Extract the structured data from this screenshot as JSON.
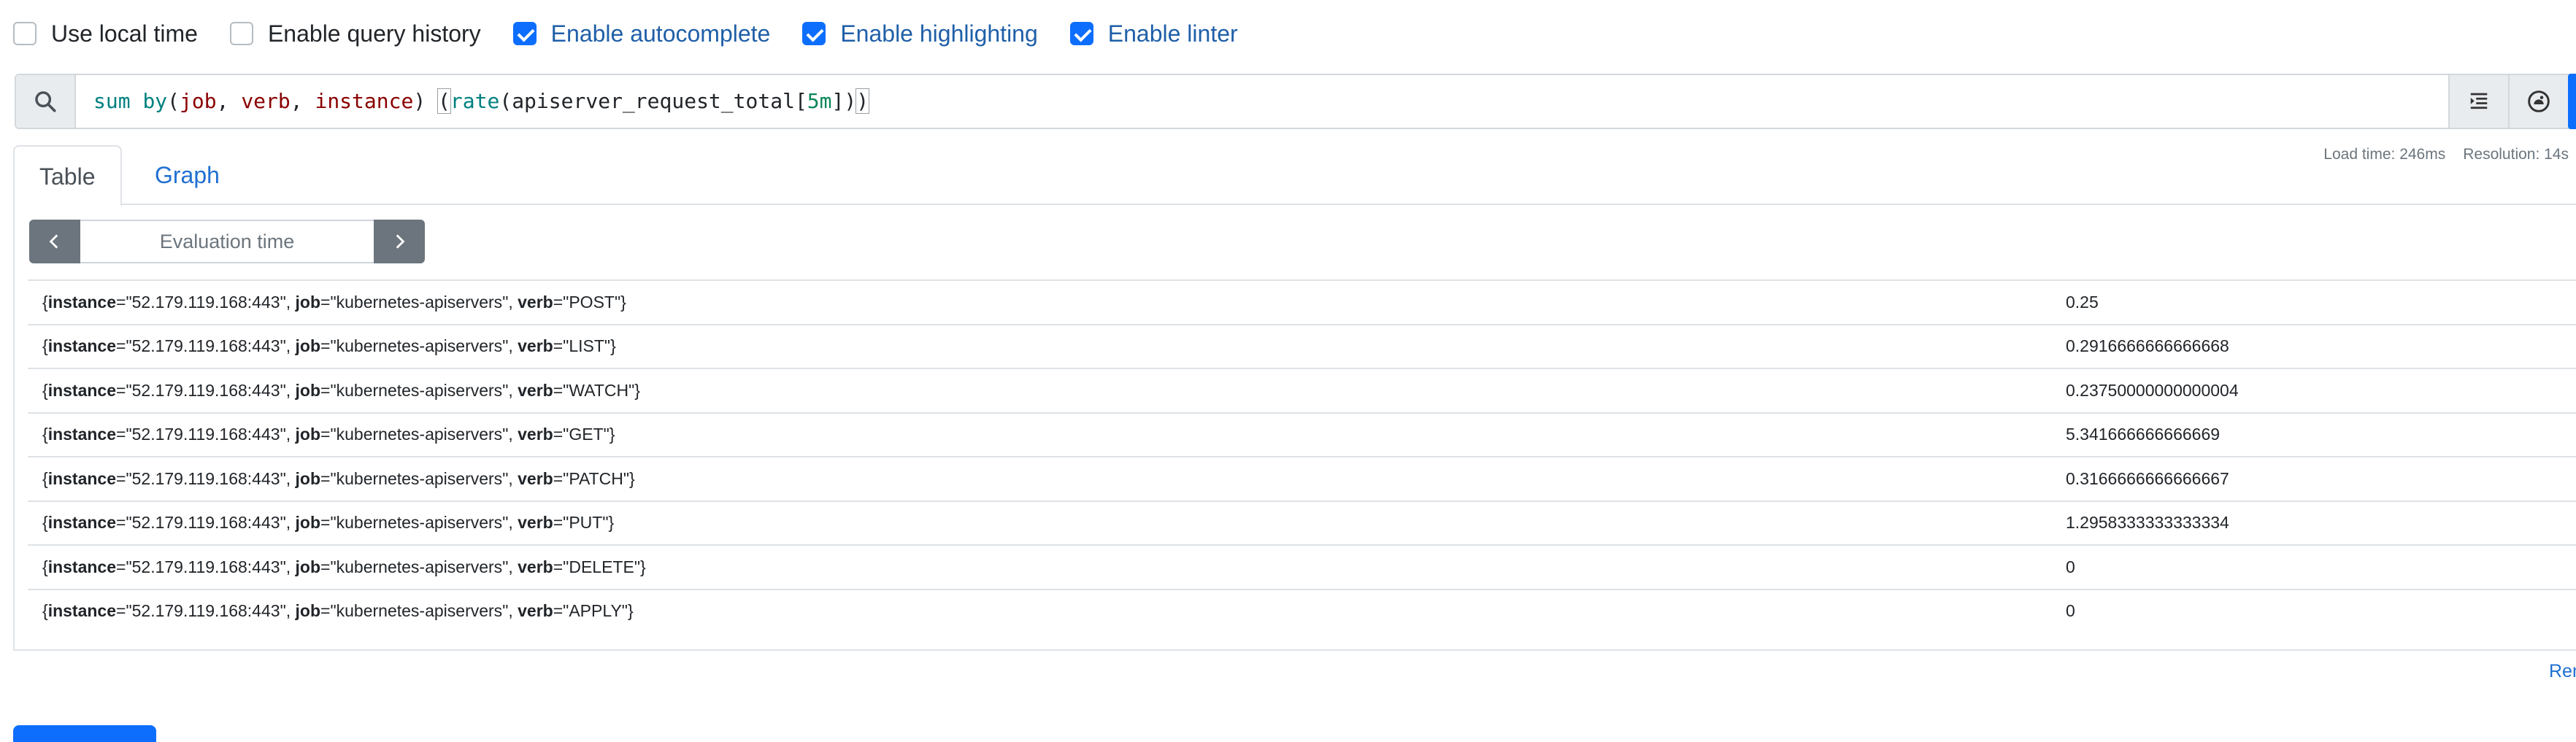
{
  "options": [
    {
      "label": "Use local time",
      "checked": false
    },
    {
      "label": "Enable query history",
      "checked": false
    },
    {
      "label": "Enable autocomplete",
      "checked": true
    },
    {
      "label": "Enable highlighting",
      "checked": true
    },
    {
      "label": "Enable linter",
      "checked": true
    }
  ],
  "expression": {
    "tokens": {
      "sum": "sum",
      "by": "by",
      "open1": "(",
      "job": "job",
      "comma1": ", ",
      "verb": "verb",
      "comma2": ", ",
      "instance": "instance",
      "close1": ") ",
      "open2": "(",
      "rate": "rate",
      "open3": "(",
      "metric": "apiserver_request_total",
      "open4": "[",
      "range": "5m",
      "close4": "]",
      "close3": ")",
      "close2": ")"
    }
  },
  "tabs": {
    "table": "Table",
    "graph": "Graph"
  },
  "stats": {
    "load_time": "Load time: 246ms",
    "resolution": "Resolution: 14s"
  },
  "eval_time": {
    "placeholder": "Evaluation time"
  },
  "results": [
    {
      "instance": "52.179.119.168:443",
      "job": "kubernetes-apiservers",
      "verb": "POST",
      "value": "0.25"
    },
    {
      "instance": "52.179.119.168:443",
      "job": "kubernetes-apiservers",
      "verb": "LIST",
      "value": "0.2916666666666668"
    },
    {
      "instance": "52.179.119.168:443",
      "job": "kubernetes-apiservers",
      "verb": "WATCH",
      "value": "0.23750000000000004"
    },
    {
      "instance": "52.179.119.168:443",
      "job": "kubernetes-apiservers",
      "verb": "GET",
      "value": "5.341666666666669"
    },
    {
      "instance": "52.179.119.168:443",
      "job": "kubernetes-apiservers",
      "verb": "PATCH",
      "value": "0.3166666666666667"
    },
    {
      "instance": "52.179.119.168:443",
      "job": "kubernetes-apiservers",
      "verb": "PUT",
      "value": "1.2958333333333334"
    },
    {
      "instance": "52.179.119.168:443",
      "job": "kubernetes-apiservers",
      "verb": "DELETE",
      "value": "0"
    },
    {
      "instance": "52.179.119.168:443",
      "job": "kubernetes-apiservers",
      "verb": "APPLY",
      "value": "0"
    }
  ],
  "remove_panel": "Rem",
  "icons": {
    "search": "search-icon",
    "format": "format-expression-icon",
    "metrics": "metrics-explorer-icon",
    "prev": "chevron-left-icon",
    "next": "chevron-right-icon"
  },
  "colors": {
    "accent": "#0d6efd",
    "link": "#1f6fd1"
  }
}
